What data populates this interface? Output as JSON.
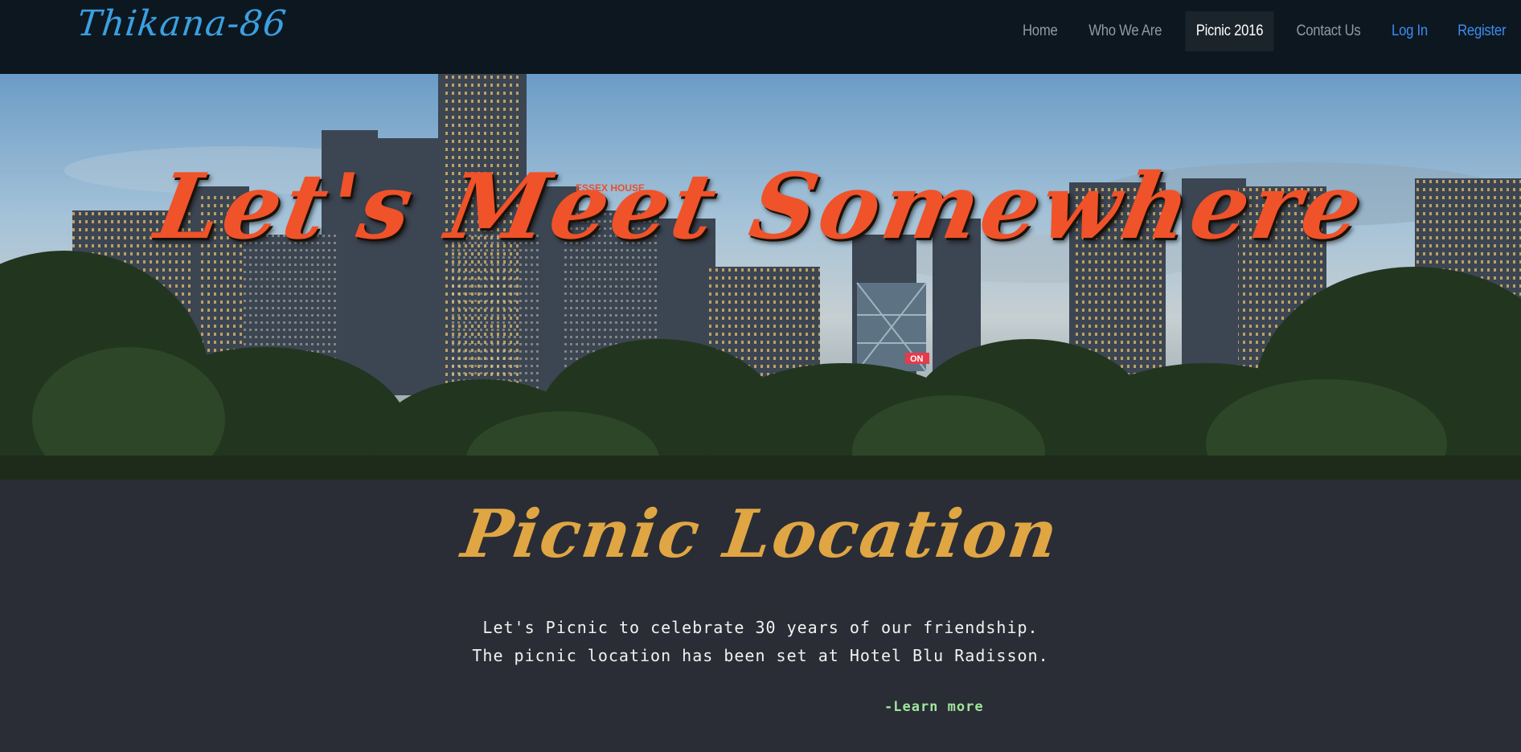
{
  "brand": {
    "name": "Thikana-86"
  },
  "nav": {
    "items": [
      {
        "label": "Home"
      },
      {
        "label": "Who We Are"
      },
      {
        "label": "Picnic 2016"
      },
      {
        "label": "Contact Us"
      },
      {
        "label": "Log In"
      },
      {
        "label": "Register"
      }
    ]
  },
  "hero": {
    "title": "Let's Meet Somewhere",
    "sign_text": "ESSEX HOUSE",
    "neon_text": "ON"
  },
  "section": {
    "title": "Picnic Location",
    "line1": "Let's Picnic to celebrate 30 years of our friendship.",
    "line2": "The picnic location has been set at Hotel Blu Radisson.",
    "learn_more": "-Learn more"
  },
  "colors": {
    "navbar_bg": "#0d1720",
    "brand": "#3aa0e0",
    "nav_text": "#8f9aa4",
    "nav_active_bg": "#1b232b",
    "nav_accent": "#3c8cf0",
    "hero_title": "#f0522a",
    "section_bg": "#2a2d35",
    "section_title": "#e0a643",
    "learn_more": "#9fe69c"
  }
}
